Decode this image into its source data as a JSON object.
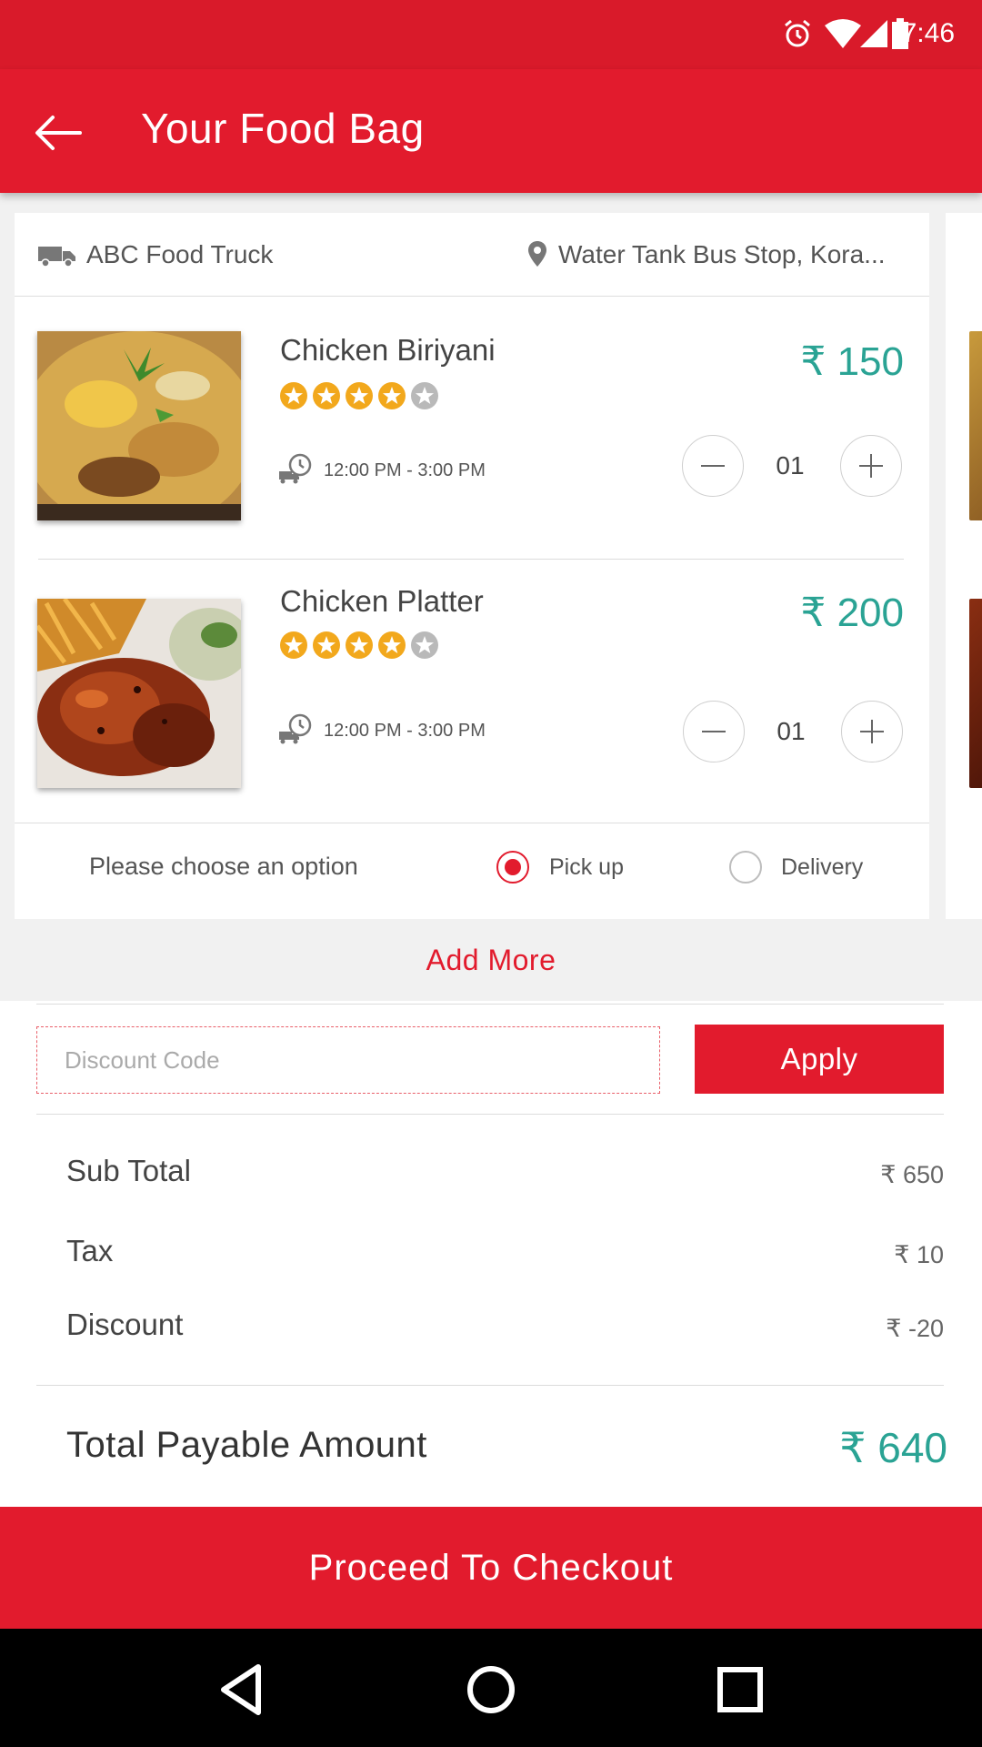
{
  "status_bar": {
    "time": "7:46",
    "icons": [
      "alarm-icon",
      "wifi-icon",
      "signal-icon",
      "battery-icon"
    ]
  },
  "app_bar": {
    "title": "Your Food Bag",
    "back_icon": "arrow-left-icon"
  },
  "vendor": {
    "name": "ABC Food Truck",
    "location": "Water Tank Bus Stop, Kora..."
  },
  "items": [
    {
      "name": "Chicken Biriyani",
      "price": "₹ 150",
      "rating": 4,
      "rating_max": 5,
      "time_slot": "12:00 PM - 3:00 PM",
      "quantity": "01"
    },
    {
      "name": "Chicken Platter",
      "price": "₹ 200",
      "rating": 4,
      "rating_max": 5,
      "time_slot": "12:00 PM - 3:00 PM",
      "quantity": "01"
    }
  ],
  "options": {
    "prompt": "Please choose an option",
    "pickup_label": "Pick up",
    "delivery_label": "Delivery",
    "selected": "Pick up"
  },
  "add_more_label": "Add More",
  "discount": {
    "placeholder": "Discount Code",
    "apply_label": "Apply"
  },
  "summary": {
    "subtotal_label": "Sub Total",
    "subtotal_value": "₹ 650",
    "tax_label": "Tax",
    "tax_value": "₹ 10",
    "discount_label": "Discount",
    "discount_value": "₹ -20",
    "total_label": "Total Payable Amount",
    "total_value": "₹ 640"
  },
  "checkout_label": "Proceed To Checkout",
  "colors": {
    "primary": "#e21b2d",
    "price": "#2aa394",
    "star": "#f2a81c"
  }
}
